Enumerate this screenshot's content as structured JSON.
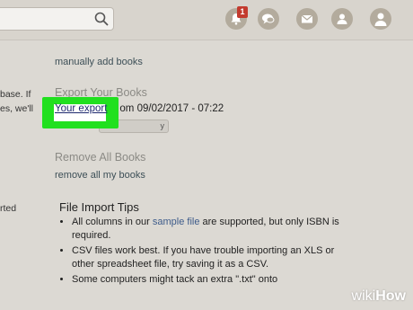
{
  "nav": {
    "badge_count": "1",
    "icons": [
      "search-icon",
      "bell-icon",
      "chat-icon",
      "mail-icon",
      "friends-icon",
      "profile-icon"
    ]
  },
  "left_fragments": [
    "base. If",
    "es, we'll",
    "rted"
  ],
  "import": {
    "manual_link": "manually add books"
  },
  "export": {
    "heading": "Export Your Books",
    "link": "Your export",
    "suffix": "om 09/02/2017 - 07:22",
    "button_fragment": "y"
  },
  "remove": {
    "heading": "Remove All Books",
    "link": "remove all my books"
  },
  "tips": {
    "heading": "File Import Tips",
    "items": [
      {
        "pre": "All columns in our ",
        "link": "sample file",
        "post": " are supported, but only ISBN is required."
      },
      {
        "text": "CSV files work best. If you have trouble importing an XLS or other spreadsheet file, try saving it as a CSV."
      },
      {
        "text": "Some computers might tack an extra \".txt\" onto"
      }
    ]
  },
  "watermark": {
    "wiki": "wiki",
    "how": "How"
  },
  "colors": {
    "highlight": "#21e01f",
    "badge": "#c33a2e",
    "link": "#1f2a6f"
  }
}
